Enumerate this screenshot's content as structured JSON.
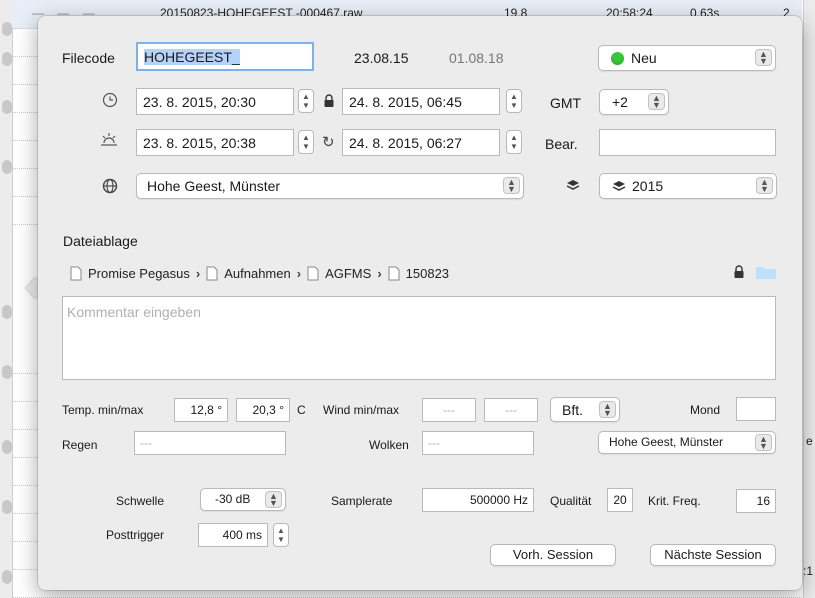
{
  "background": {
    "top_row": {
      "filename": "20150823-HOHEGEEST -000467.raw",
      "value": "19.8",
      "time": "20:58:24",
      "duration": "0.63s",
      "count": "2"
    },
    "right_fragments": [
      "e",
      ":1"
    ]
  },
  "popover": {
    "filecode_label": "Filecode",
    "filecode_value": "HOHEGEEST_",
    "date_a": "23.08.15",
    "date_b": "01.08.18",
    "status_value": "Neu",
    "status_color": "#37c837",
    "start_1": "23. 8. 2015, 20:30",
    "end_1": "24. 8. 2015, 06:45",
    "start_2": "23. 8. 2015, 20:38",
    "end_2": "24. 8. 2015, 06:27",
    "gmt_label": "GMT",
    "gmt_value": "+2",
    "bear_label": "Bear.",
    "bear_value": "",
    "location_value": "Hohe Geest, Münster",
    "layer_value": "2015",
    "dateiablage_label": "Dateiablage",
    "path": [
      "Promise Pegasus",
      "Aufnahmen",
      "AGFMS",
      "150823"
    ],
    "folder_color": "#bfe0f8",
    "comment_placeholder": "Kommentar eingeben",
    "temp_label": "Temp. min/max",
    "temp_min": "12,8 °",
    "temp_max": "20,3 °",
    "temp_unit": "C",
    "wind_label": "Wind min/max",
    "wind_min_placeholder": "---",
    "wind_max_placeholder": "---",
    "wind_unit": "Bft.",
    "mond_label": "Mond",
    "regen_label": "Regen",
    "regen_placeholder": "---",
    "wolken_label": "Wolken",
    "wolken_placeholder": "---",
    "weather_location": "Hohe Geest, Münster",
    "schwelle_label": "Schwelle",
    "schwelle_value": "-30 dB",
    "samplerate_label": "Samplerate",
    "samplerate_value": "500000 Hz",
    "qualitaet_label": "Qualität",
    "qualitaet_value": "20",
    "krit_label": "Krit. Freq.",
    "krit_value": "16",
    "posttrigger_label": "Posttrigger",
    "posttrigger_value": "400 ms",
    "prev_session": "Vorh. Session",
    "next_session": "Nächste Session"
  }
}
